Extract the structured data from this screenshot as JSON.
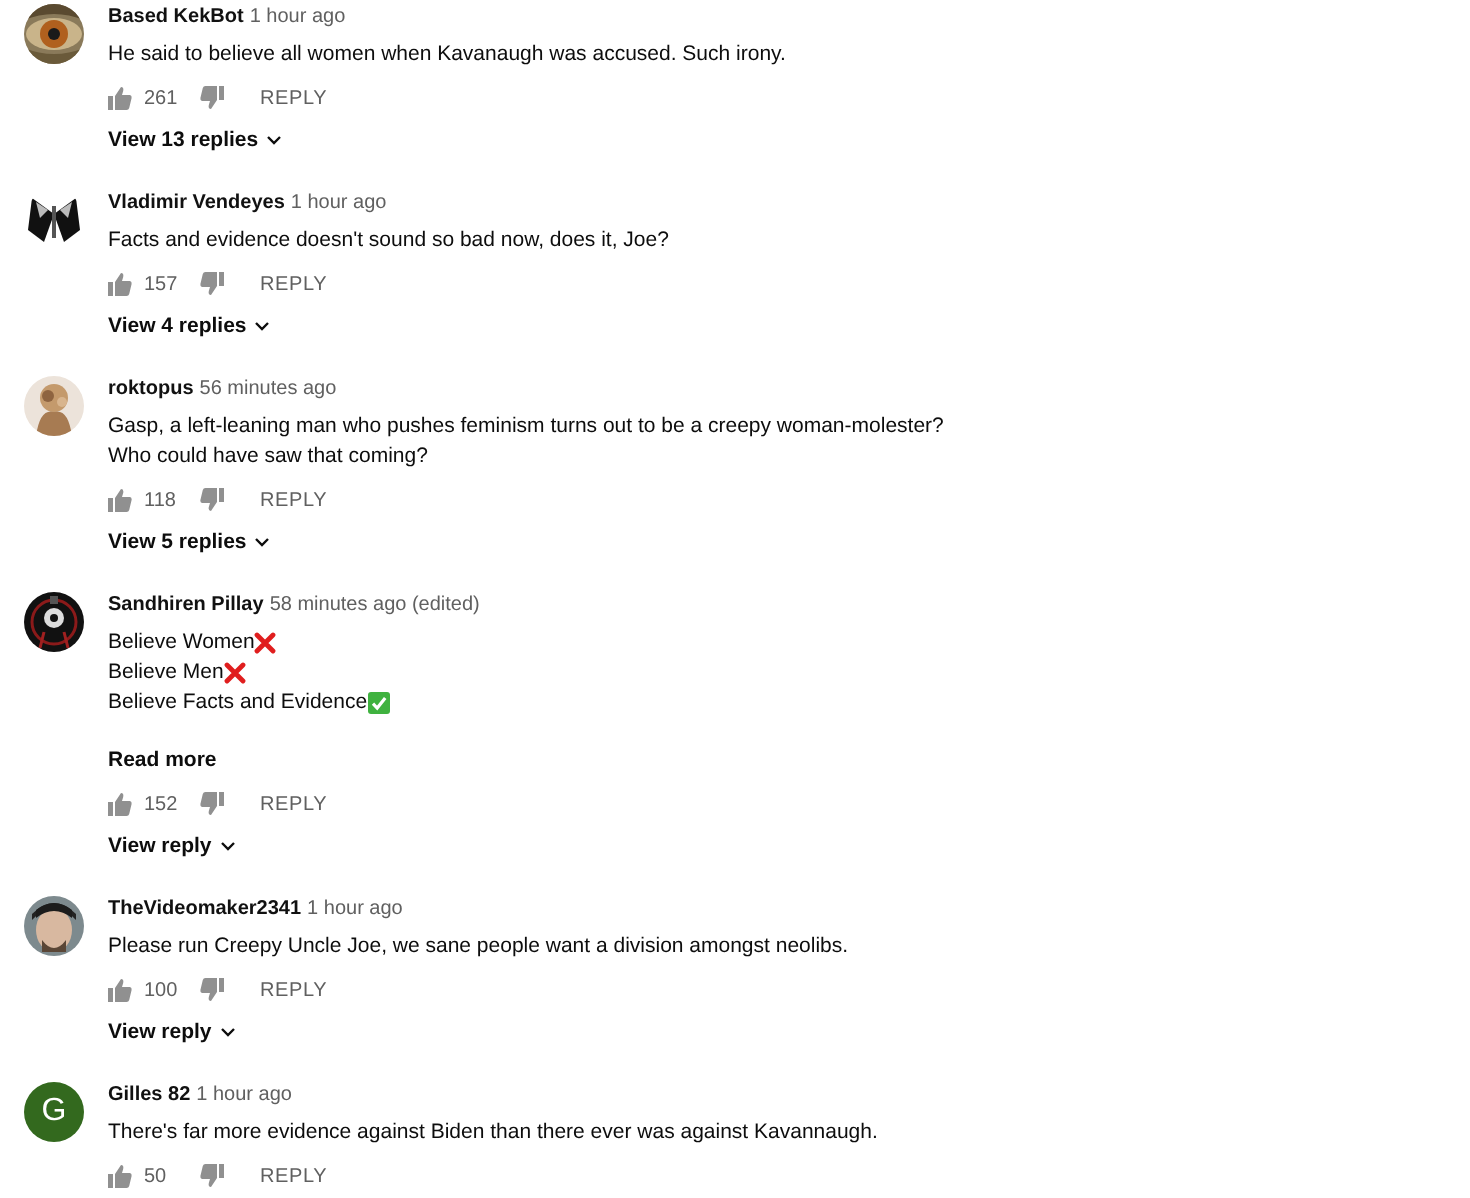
{
  "comments": [
    {
      "author": "Based KekBot",
      "time": "1 hour ago",
      "avatar": {
        "kind": "picture"
      },
      "lines": [
        {
          "kind": "plain",
          "text": "He said to believe all women when Kavanaugh was accused. Such irony."
        }
      ],
      "likes": "261",
      "reply": "REPLY",
      "replies": "View 13 replies"
    },
    {
      "author": "Vladimir Vendeyes",
      "time": "1 hour ago",
      "avatar": {
        "kind": "picture"
      },
      "lines": [
        {
          "kind": "plain",
          "text": "Facts and evidence doesn't sound so bad now, does it, Joe?"
        }
      ],
      "likes": "157",
      "reply": "REPLY",
      "replies": "View 4 replies"
    },
    {
      "author": "roktopus",
      "time": "56 minutes ago",
      "avatar": {
        "kind": "picture"
      },
      "lines": [
        {
          "kind": "plain",
          "text": "Gasp, a left-leaning man who pushes feminism turns out to be a creepy woman-molester?"
        },
        {
          "kind": "plain",
          "text": "Who could have  saw that coming?"
        }
      ],
      "likes": "118",
      "reply": "REPLY",
      "replies": "View 5 replies"
    },
    {
      "author": "Sandhiren Pillay",
      "time": "58 minutes ago (edited)",
      "avatar": {
        "kind": "picture"
      },
      "lines": [
        {
          "kind": "cross",
          "text": "Believe Women"
        },
        {
          "kind": "cross",
          "text": "Believe Men"
        },
        {
          "kind": "check",
          "text": "Believe Facts and Evidence"
        }
      ],
      "read_more": "Read more",
      "likes": "152",
      "reply": "REPLY",
      "replies": "View reply"
    },
    {
      "author": "TheVideomaker2341",
      "time": "1 hour ago",
      "avatar": {
        "kind": "picture"
      },
      "lines": [
        {
          "kind": "plain",
          "text": "Please run Creepy Uncle Joe, we sane people want a division amongst neolibs."
        }
      ],
      "likes": "100",
      "reply": "REPLY",
      "replies": "View reply"
    },
    {
      "author": "Gilles 82",
      "time": "1 hour ago",
      "avatar": {
        "kind": "letter",
        "letter": "G",
        "color": "#33691e"
      },
      "lines": [
        {
          "kind": "plain",
          "text": "There's far more evidence against Biden than there ever was against Kavannaugh."
        }
      ],
      "likes": "50",
      "reply": "REPLY"
    }
  ]
}
